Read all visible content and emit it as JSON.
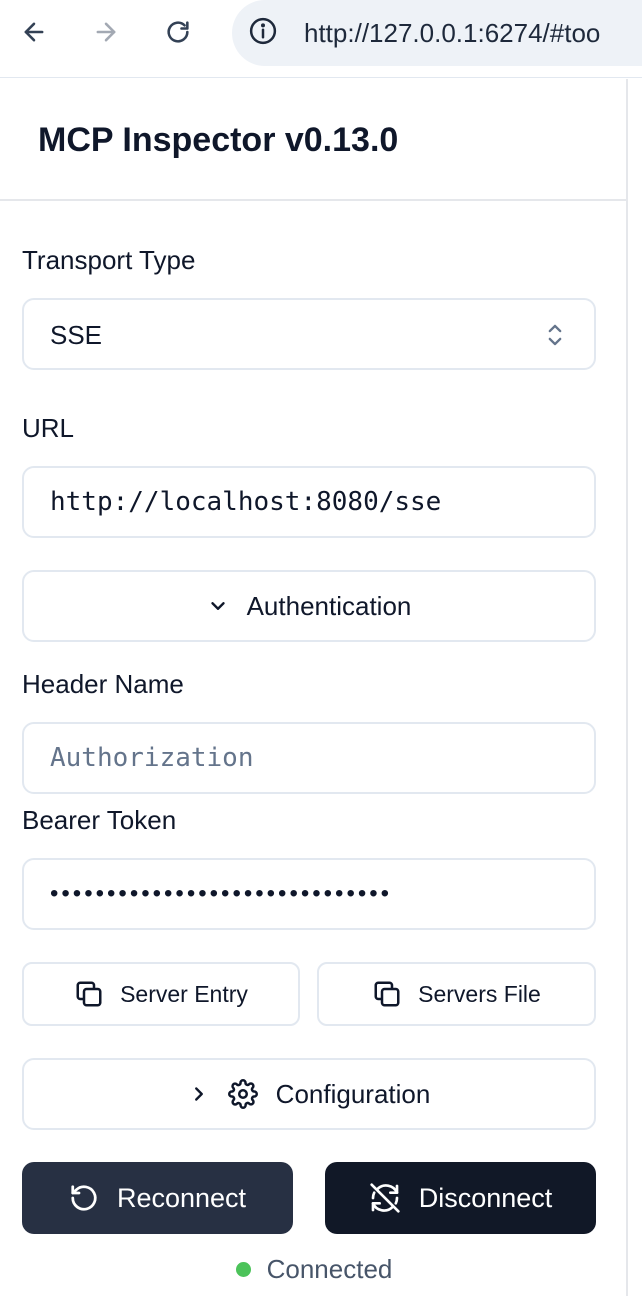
{
  "browser": {
    "url": "http://127.0.0.1:6274/#too"
  },
  "header": {
    "title": "MCP Inspector v0.13.0"
  },
  "transport": {
    "label": "Transport Type",
    "value": "SSE"
  },
  "url_field": {
    "label": "URL",
    "value": "http://localhost:8080/sse"
  },
  "authentication": {
    "label": "Authentication",
    "header_name_label": "Header Name",
    "header_name_placeholder": "Authorization",
    "bearer_token_label": "Bearer Token",
    "bearer_token_masked": "••••••••••••••••••••••••••••••"
  },
  "buttons": {
    "server_entry": "Server Entry",
    "servers_file": "Servers File",
    "configuration": "Configuration",
    "reconnect": "Reconnect",
    "disconnect": "Disconnect"
  },
  "status": {
    "text": "Connected"
  },
  "colors": {
    "reconnect_bg": "#273043",
    "disconnect_bg": "#111827",
    "status_dot": "#4cc35a"
  }
}
